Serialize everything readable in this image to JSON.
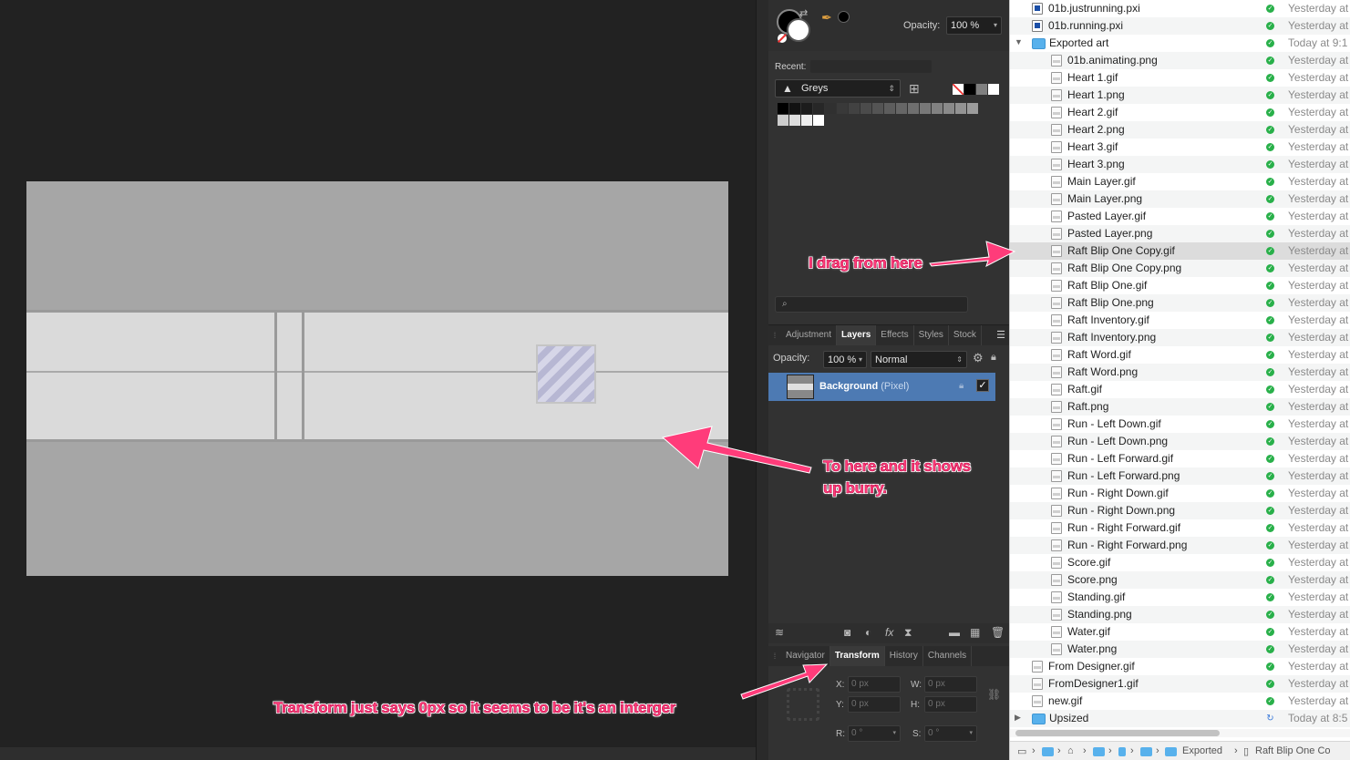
{
  "color_panel": {
    "opacity_label": "Opacity:",
    "opacity_value": "100 %",
    "recent_label": "Recent:",
    "palette_name": "Greys",
    "palette_icon": "affinity-palette-icon",
    "quick_swatch_colors": [
      "#ffffff",
      "#000000",
      "#808080",
      "#ffffff"
    ],
    "grey_swatch_colors": [
      [
        "#000000",
        "#111111",
        "#1c1c1c",
        "#272727",
        "#303030",
        "#393939",
        "#424242",
        "#4b4b4b",
        "#545454",
        "#5d5d5d",
        "#666666",
        "#6f6f6f",
        "#787878",
        "#818181",
        "#8a8a8a",
        "#939393",
        "#9c9c9c"
      ],
      [
        "#cccccc",
        "#dddddd",
        "#eeeeee",
        "#ffffff"
      ]
    ]
  },
  "panel_tabs": {
    "top": [
      "Adjustment",
      "Layers",
      "Effects",
      "Styles",
      "Stock"
    ],
    "top_active": "Layers",
    "bottom": [
      "Navigator",
      "Transform",
      "History",
      "Channels"
    ],
    "bottom_active": "Transform"
  },
  "layers": {
    "opacity_label": "Opacity:",
    "opacity_value": "100 %",
    "blend_mode": "Normal",
    "items": [
      {
        "name": "Background",
        "kind": "(Pixel)",
        "visible": true,
        "locked": true
      }
    ]
  },
  "transform": {
    "x_label": "X:",
    "x_value": "0 px",
    "y_label": "Y:",
    "y_value": "0 px",
    "w_label": "W:",
    "w_value": "0 px",
    "h_label": "H:",
    "h_value": "0 px",
    "r_label": "R:",
    "r_value": "0 °",
    "s_label": "S:",
    "s_value": "0 °"
  },
  "finder": {
    "rows": [
      {
        "name": "01b.justrunning.pxi",
        "date": "Yesterday at",
        "indent": 1,
        "type": "doc",
        "status": "synced"
      },
      {
        "name": "01b.running.pxi",
        "date": "Yesterday at",
        "indent": 1,
        "type": "doc",
        "status": "synced"
      },
      {
        "name": "Exported art",
        "date": "Today at 9:1",
        "indent": 1,
        "type": "folder",
        "status": "synced",
        "expanded": true
      },
      {
        "name": "01b.animating.png",
        "date": "Yesterday at",
        "indent": 2,
        "type": "img",
        "status": "synced"
      },
      {
        "name": "Heart 1.gif",
        "date": "Yesterday at",
        "indent": 2,
        "type": "img",
        "status": "synced"
      },
      {
        "name": "Heart 1.png",
        "date": "Yesterday at",
        "indent": 2,
        "type": "img",
        "status": "synced"
      },
      {
        "name": "Heart 2.gif",
        "date": "Yesterday at",
        "indent": 2,
        "type": "img",
        "status": "synced"
      },
      {
        "name": "Heart 2.png",
        "date": "Yesterday at",
        "indent": 2,
        "type": "img",
        "status": "synced"
      },
      {
        "name": "Heart 3.gif",
        "date": "Yesterday at",
        "indent": 2,
        "type": "img",
        "status": "synced"
      },
      {
        "name": "Heart 3.png",
        "date": "Yesterday at",
        "indent": 2,
        "type": "img",
        "status": "synced"
      },
      {
        "name": "Main Layer.gif",
        "date": "Yesterday at",
        "indent": 2,
        "type": "img",
        "status": "synced"
      },
      {
        "name": "Main Layer.png",
        "date": "Yesterday at",
        "indent": 2,
        "type": "img",
        "status": "synced"
      },
      {
        "name": "Pasted Layer.gif",
        "date": "Yesterday at",
        "indent": 2,
        "type": "img",
        "status": "synced"
      },
      {
        "name": "Pasted Layer.png",
        "date": "Yesterday at",
        "indent": 2,
        "type": "img",
        "status": "synced"
      },
      {
        "name": "Raft Blip One Copy.gif",
        "date": "Yesterday at",
        "indent": 2,
        "type": "img",
        "status": "synced",
        "selected": true
      },
      {
        "name": "Raft Blip One Copy.png",
        "date": "Yesterday at",
        "indent": 2,
        "type": "img",
        "status": "synced"
      },
      {
        "name": "Raft Blip One.gif",
        "date": "Yesterday at",
        "indent": 2,
        "type": "img",
        "status": "synced"
      },
      {
        "name": "Raft Blip One.png",
        "date": "Yesterday at",
        "indent": 2,
        "type": "img",
        "status": "synced"
      },
      {
        "name": "Raft Inventory.gif",
        "date": "Yesterday at",
        "indent": 2,
        "type": "img",
        "status": "synced"
      },
      {
        "name": "Raft Inventory.png",
        "date": "Yesterday at",
        "indent": 2,
        "type": "img",
        "status": "synced"
      },
      {
        "name": "Raft Word.gif",
        "date": "Yesterday at",
        "indent": 2,
        "type": "img",
        "status": "synced"
      },
      {
        "name": "Raft Word.png",
        "date": "Yesterday at",
        "indent": 2,
        "type": "img",
        "status": "synced"
      },
      {
        "name": "Raft.gif",
        "date": "Yesterday at",
        "indent": 2,
        "type": "img",
        "status": "synced"
      },
      {
        "name": "Raft.png",
        "date": "Yesterday at",
        "indent": 2,
        "type": "img",
        "status": "synced"
      },
      {
        "name": "Run - Left Down.gif",
        "date": "Yesterday at",
        "indent": 2,
        "type": "img",
        "status": "synced"
      },
      {
        "name": "Run - Left Down.png",
        "date": "Yesterday at",
        "indent": 2,
        "type": "img",
        "status": "synced"
      },
      {
        "name": "Run - Left Forward.gif",
        "date": "Yesterday at",
        "indent": 2,
        "type": "img",
        "status": "synced"
      },
      {
        "name": "Run - Left Forward.png",
        "date": "Yesterday at",
        "indent": 2,
        "type": "img",
        "status": "synced"
      },
      {
        "name": "Run - Right Down.gif",
        "date": "Yesterday at",
        "indent": 2,
        "type": "img",
        "status": "synced"
      },
      {
        "name": "Run - Right Down.png",
        "date": "Yesterday at",
        "indent": 2,
        "type": "img",
        "status": "synced"
      },
      {
        "name": "Run - Right Forward.gif",
        "date": "Yesterday at",
        "indent": 2,
        "type": "img",
        "status": "synced"
      },
      {
        "name": "Run - Right Forward.png",
        "date": "Yesterday at",
        "indent": 2,
        "type": "img",
        "status": "synced"
      },
      {
        "name": "Score.gif",
        "date": "Yesterday at",
        "indent": 2,
        "type": "img",
        "status": "synced"
      },
      {
        "name": "Score.png",
        "date": "Yesterday at",
        "indent": 2,
        "type": "img",
        "status": "synced"
      },
      {
        "name": "Standing.gif",
        "date": "Yesterday at",
        "indent": 2,
        "type": "img",
        "status": "synced"
      },
      {
        "name": "Standing.png",
        "date": "Yesterday at",
        "indent": 2,
        "type": "img",
        "status": "synced"
      },
      {
        "name": "Water.gif",
        "date": "Yesterday at",
        "indent": 2,
        "type": "img",
        "status": "synced"
      },
      {
        "name": "Water.png",
        "date": "Yesterday at",
        "indent": 2,
        "type": "img",
        "status": "synced"
      },
      {
        "name": "From Designer.gif",
        "date": "Yesterday at",
        "indent": 1,
        "type": "img",
        "status": "synced"
      },
      {
        "name": "FromDesigner1.gif",
        "date": "Yesterday at",
        "indent": 1,
        "type": "img",
        "status": "synced"
      },
      {
        "name": "new.gif",
        "date": "Yesterday at",
        "indent": 1,
        "type": "img",
        "status": "synced"
      },
      {
        "name": "Upsized",
        "date": "Today at 8:5",
        "indent": 1,
        "type": "folder",
        "status": "syncing",
        "expanded": false
      }
    ],
    "path_bar": {
      "exported_label": "Exported",
      "selected_label": "Raft Blip One Co"
    }
  },
  "annotations": {
    "drag_from": "I drag from here",
    "drop_to_line1": "To here and it shows",
    "drop_to_line2": "up burry.",
    "transform_note": "Transform just says 0px so it seems to be it's an interger",
    "color": "#ff3c7a"
  }
}
